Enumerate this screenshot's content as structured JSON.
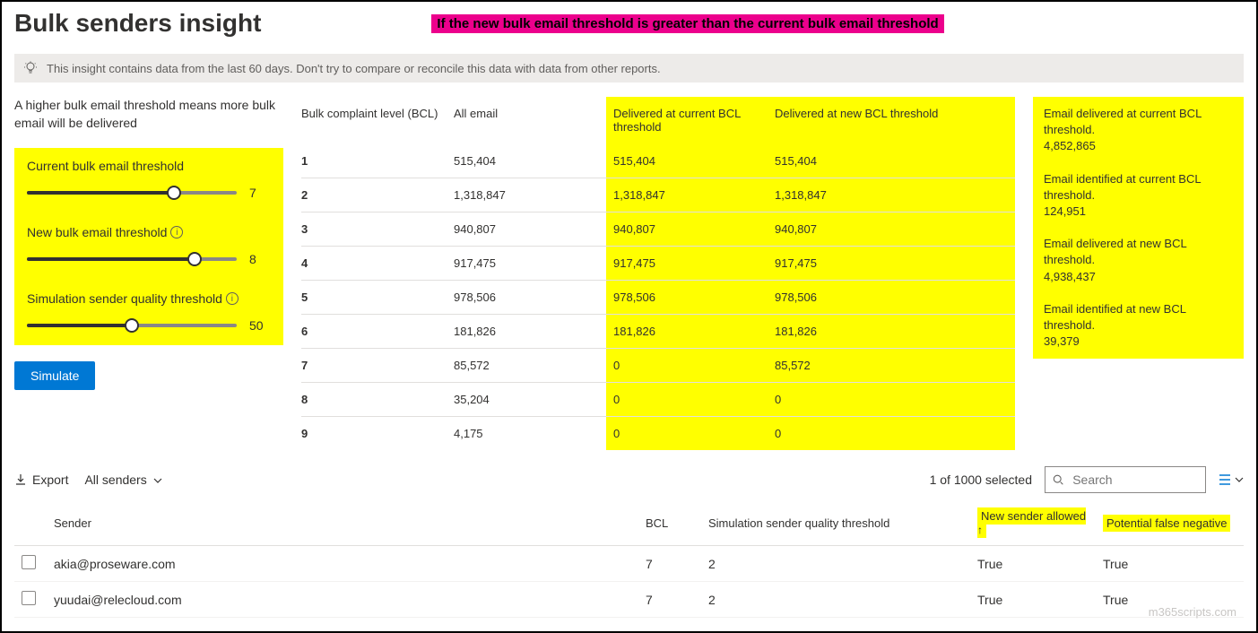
{
  "header": {
    "title": "Bulk senders insight",
    "banner": "If the new bulk email threshold is greater than the current bulk email threshold"
  },
  "info_bar": "This insight contains data from the last 60 days. Don't try to compare or reconcile this data with data from other reports.",
  "left": {
    "description": "A higher bulk email threshold means more bulk email will be delivered",
    "sliders": {
      "current": {
        "label": "Current bulk email threshold",
        "value": "7",
        "pct": 70
      },
      "new": {
        "label": "New bulk email threshold",
        "value": "8",
        "pct": 80
      },
      "sim": {
        "label": "Simulation sender quality threshold",
        "value": "50",
        "pct": 50
      }
    },
    "simulate_button": "Simulate"
  },
  "bcl_table": {
    "headers": {
      "bcl": "Bulk complaint level (BCL)",
      "all": "All email",
      "cur": "Delivered at current BCL threshold",
      "new": "Delivered at new BCL threshold"
    },
    "rows": [
      {
        "bcl": "1",
        "all": "515,404",
        "cur": "515,404",
        "new": "515,404"
      },
      {
        "bcl": "2",
        "all": "1,318,847",
        "cur": "1,318,847",
        "new": "1,318,847"
      },
      {
        "bcl": "3",
        "all": "940,807",
        "cur": "940,807",
        "new": "940,807"
      },
      {
        "bcl": "4",
        "all": "917,475",
        "cur": "917,475",
        "new": "917,475"
      },
      {
        "bcl": "5",
        "all": "978,506",
        "cur": "978,506",
        "new": "978,506"
      },
      {
        "bcl": "6",
        "all": "181,826",
        "cur": "181,826",
        "new": "181,826"
      },
      {
        "bcl": "7",
        "all": "85,572",
        "cur": "0",
        "new": "85,572"
      },
      {
        "bcl": "8",
        "all": "35,204",
        "cur": "0",
        "new": "0"
      },
      {
        "bcl": "9",
        "all": "4,175",
        "cur": "0",
        "new": "0"
      }
    ]
  },
  "stats": {
    "s1_label": "Email delivered at current BCL threshold.",
    "s1_val": "4,852,865",
    "s2_label": "Email identified at current BCL threshold.",
    "s2_val": "124,951",
    "s3_label": "Email delivered at new BCL threshold.",
    "s3_val": "4,938,437",
    "s4_label": "Email identified at new BCL threshold.",
    "s4_val": "39,379"
  },
  "toolbar": {
    "export": "Export",
    "filter": "All senders",
    "selected": "1 of 1000 selected",
    "search_placeholder": "Search"
  },
  "senders_table": {
    "headers": {
      "sender": "Sender",
      "bcl": "BCL",
      "sim": "Simulation sender quality threshold",
      "new_allowed": "New sender allowed",
      "pfn": "Potential false negative"
    },
    "rows": [
      {
        "sender": "akia@proseware.com",
        "bcl": "7",
        "sim": "2",
        "new_allowed": "True",
        "pfn": "True"
      },
      {
        "sender": "yuudai@relecloud.com",
        "bcl": "7",
        "sim": "2",
        "new_allowed": "True",
        "pfn": "True"
      }
    ]
  },
  "watermark": "m365scripts.com"
}
